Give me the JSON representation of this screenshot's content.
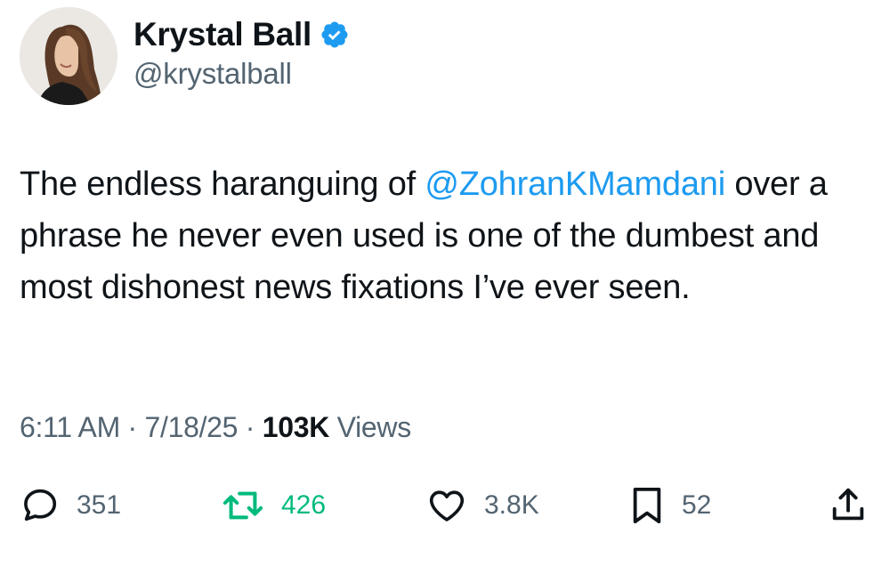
{
  "author": {
    "display_name": "Krystal Ball",
    "handle": "@krystalball",
    "verified": true,
    "verified_color": "#1d9bf0",
    "avatar_icon": "profile-photo"
  },
  "tweet": {
    "text_before": "The endless haranguing of ",
    "mention": "@ZohranKMamdani",
    "text_after": " over a phrase he never even used is one of the dumbest and most dishonest news fixations I’ve ever seen."
  },
  "meta": {
    "time": "6:11 AM",
    "sep1": " · ",
    "date": "7/18/25",
    "sep2": " · ",
    "views_count": "103K",
    "views_label": " Views"
  },
  "actions": {
    "replies": {
      "icon": "reply-icon",
      "count": "351"
    },
    "retweets": {
      "icon": "retweet-icon",
      "count": "426",
      "color": "#00ba7c"
    },
    "likes": {
      "icon": "heart-icon",
      "count": "3.8K"
    },
    "bookmarks": {
      "icon": "bookmark-icon",
      "count": "52"
    },
    "share": {
      "icon": "share-icon"
    }
  }
}
